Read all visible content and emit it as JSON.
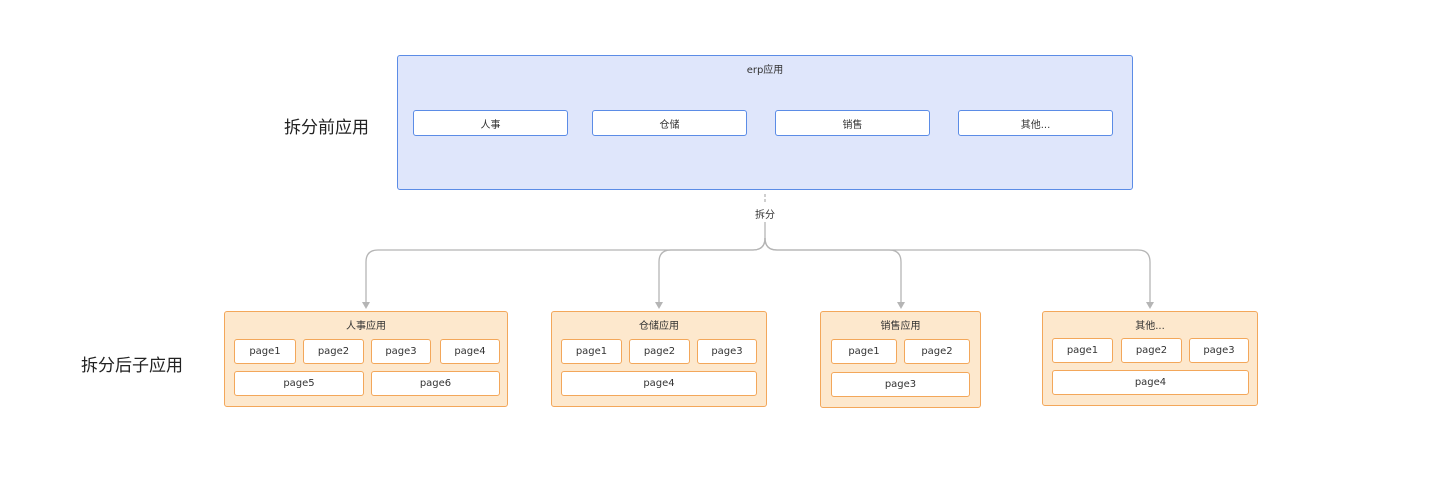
{
  "labels": {
    "before": "拆分前应用",
    "after": "拆分后子应用",
    "split": "拆分"
  },
  "erp": {
    "title": "erp应用",
    "modules": [
      "人事",
      "仓储",
      "销售",
      "其他..."
    ]
  },
  "subapps": [
    {
      "title": "人事应用",
      "pages": [
        "page1",
        "page2",
        "page3",
        "page4",
        "page5",
        "page6"
      ]
    },
    {
      "title": "仓储应用",
      "pages": [
        "page1",
        "page2",
        "page3",
        "page4"
      ]
    },
    {
      "title": "销售应用",
      "pages": [
        "page1",
        "page2",
        "page3"
      ]
    },
    {
      "title": "其他...",
      "pages": [
        "page1",
        "page2",
        "page3",
        "page4"
      ]
    }
  ],
  "colors": {
    "erp_fill": "#dfe6fb",
    "erp_stroke": "#5b8ce6",
    "sub_fill": "#fde8cd",
    "sub_stroke": "#f3a75a",
    "connector": "#b5b5b5"
  }
}
